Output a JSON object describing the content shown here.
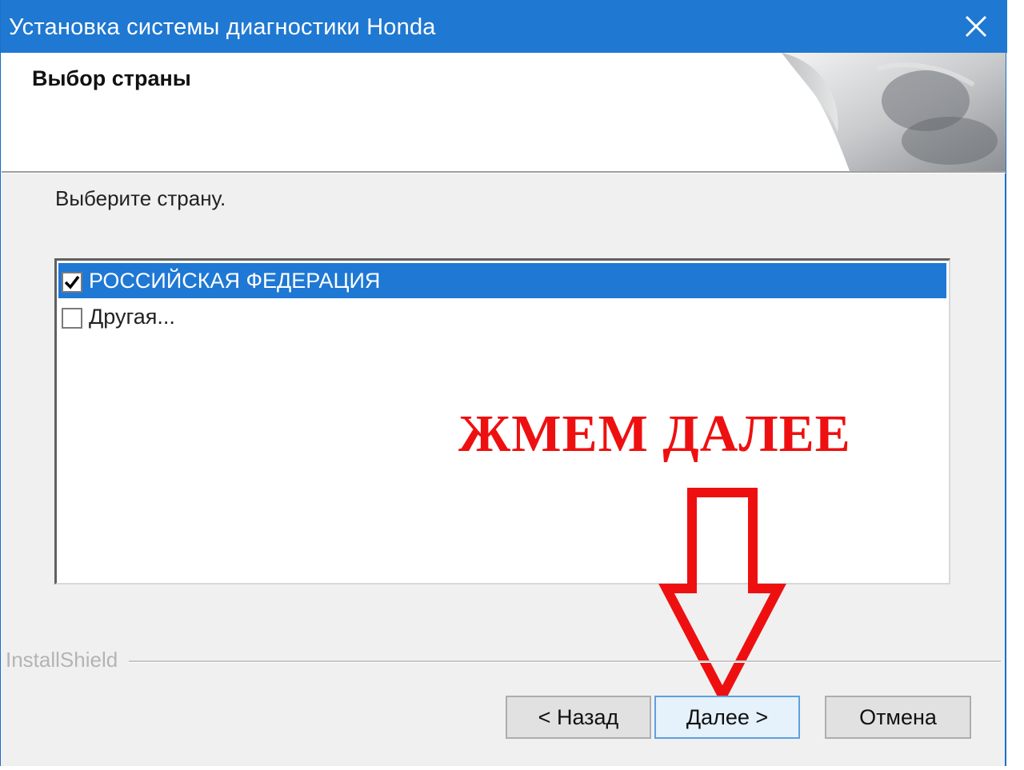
{
  "window": {
    "title": "Установка системы диагностики Honda",
    "close_icon": "close-icon",
    "accent_color": "#1f78d1"
  },
  "header": {
    "title": "Выбор страны"
  },
  "main": {
    "prompt": "Выберите страну.",
    "country_list": [
      {
        "label": "РОССИЙСКАЯ ФЕДЕРАЦИЯ",
        "checked": true,
        "selected": true
      },
      {
        "label": "Другая...",
        "checked": false,
        "selected": false
      }
    ]
  },
  "annotation": {
    "text": "ЖМЕМ ДАЛЕЕ",
    "color": "#ee1010",
    "arrow_icon": "down-arrow-icon"
  },
  "footer": {
    "brand": "InstallShield",
    "buttons": {
      "back": "< Назад",
      "next": "Далее >",
      "cancel": "Отмена"
    }
  }
}
